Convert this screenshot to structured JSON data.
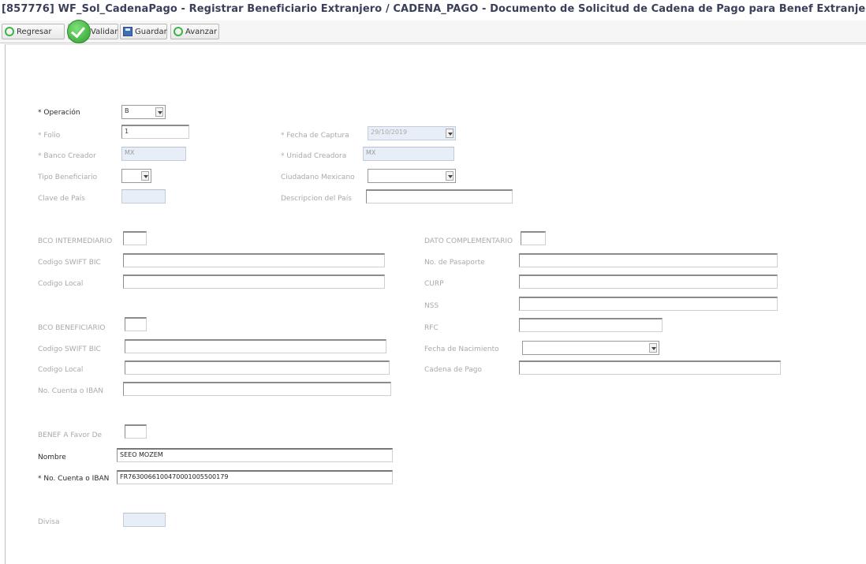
{
  "window": {
    "title": "[857776] WF_Sol_CadenaPago - Registrar Beneficiario Extranjero / CADENA_PAGO - Documento de Solicitud de Cadena de Pago para Benef Extranjeros"
  },
  "toolbar": {
    "regresar": "Regresar",
    "validar": "Validar",
    "guardar": "Guardar",
    "avanzar": "Avanzar"
  },
  "form": {
    "operacion": {
      "label": "* Operación",
      "value": "B"
    },
    "folio": {
      "label": "* Folio",
      "value": "1"
    },
    "fecha_captura": {
      "label": "* Fecha de Captura",
      "value": "29/10/2019"
    },
    "banco_creador": {
      "label": "* Banco Creador",
      "value": "MX"
    },
    "unidad_creadora": {
      "label": "* Unidad Creadora",
      "value": "MX"
    },
    "tipo_beneficiario": {
      "label": "Tipo Beneficiario",
      "value": ""
    },
    "ciudadano_mexicano": {
      "label": "Ciudadano Mexicano",
      "value": ""
    },
    "clave_pais": {
      "label": "Clave de País",
      "value": ""
    },
    "descripcion_pais": {
      "label": "Descripcion del País",
      "value": ""
    },
    "bco_intermediario": {
      "label": "BCO INTERMEDIARIO",
      "value": ""
    },
    "codigo_swift_1": {
      "label": "Codigo SWIFT BIC",
      "value": ""
    },
    "codigo_local_1": {
      "label": "Codigo Local",
      "value": ""
    },
    "bco_beneficiario": {
      "label": "BCO BENEFICIARIO",
      "value": ""
    },
    "codigo_swift_2": {
      "label": "Codigo SWIFT BIC",
      "value": ""
    },
    "codigo_local_2": {
      "label": "Codigo Local",
      "value": ""
    },
    "no_cuenta_iban_1": {
      "label": "No. Cuenta o IBAN",
      "value": ""
    },
    "benef_favor": {
      "label": "BENEF A Favor De",
      "value": ""
    },
    "nombre": {
      "label": "Nombre",
      "value": "SEEO MOZEM"
    },
    "no_cuenta_iban_2": {
      "label": "* No. Cuenta o IBAN",
      "value": "FR7630066100470001005500179"
    },
    "divisa": {
      "label": "Divisa",
      "value": ""
    },
    "dato_complementario": {
      "label": "DATO COMPLEMENTARIO",
      "value": ""
    },
    "pasaporte": {
      "label": "No. de Pasaporte",
      "value": ""
    },
    "curp": {
      "label": "CURP",
      "value": ""
    },
    "nss": {
      "label": "NSS",
      "value": ""
    },
    "rfc": {
      "label": "RFC",
      "value": ""
    },
    "fecha_nacimiento": {
      "label": "Fecha de Nacimiento",
      "value": ""
    },
    "cadena_pago": {
      "label": "Cadena de Pago",
      "value": ""
    }
  },
  "colors": {
    "title_text": "#3a3f5a",
    "readonly_bg": "#e8eef7",
    "accent_green": "#3db34a"
  }
}
